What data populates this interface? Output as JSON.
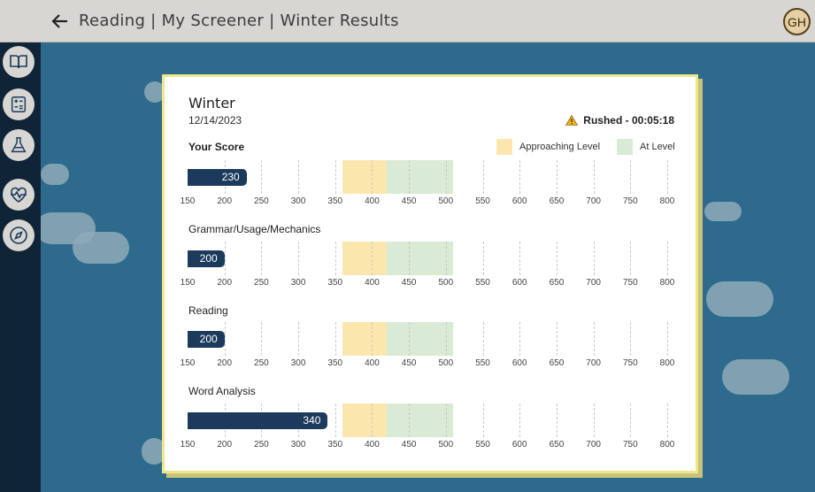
{
  "header": {
    "title": "Reading | My Screener | Winter Results",
    "avatar_initials": "GH"
  },
  "sidebar": {
    "items": [
      {
        "name": "book-icon"
      },
      {
        "name": "calculator-icon"
      },
      {
        "name": "flask-icon"
      },
      {
        "name": "heart-pulse-icon"
      },
      {
        "name": "compass-icon"
      }
    ]
  },
  "card": {
    "season": "Winter",
    "date": "12/14/2023",
    "rushed": "Rushed - 00:05:18",
    "legend": {
      "approaching": "Approaching Level",
      "at_level": "At Level"
    },
    "colors": {
      "approaching": "#fbe7ad",
      "at_level": "#d9ead5",
      "score_bar": "#1c3a5b"
    }
  },
  "chart_data": {
    "type": "bar",
    "axis": {
      "min": 150,
      "max": 800,
      "ticks": [
        150,
        200,
        250,
        300,
        350,
        400,
        450,
        500,
        550,
        600,
        650,
        700,
        750,
        800
      ]
    },
    "bands": [
      {
        "label": "Approaching Level",
        "from": 360,
        "to": 420
      },
      {
        "label": "At Level",
        "from": 420,
        "to": 510
      }
    ],
    "scores": [
      {
        "label": "Your Score",
        "value": 230,
        "display": "230"
      },
      {
        "label": "Grammar/Usage/Mechanics",
        "value": 200,
        "display": "200"
      },
      {
        "label": "Reading",
        "value": 200,
        "display": "200"
      },
      {
        "label": "Word Analysis",
        "value": 340,
        "display": "340"
      }
    ]
  }
}
